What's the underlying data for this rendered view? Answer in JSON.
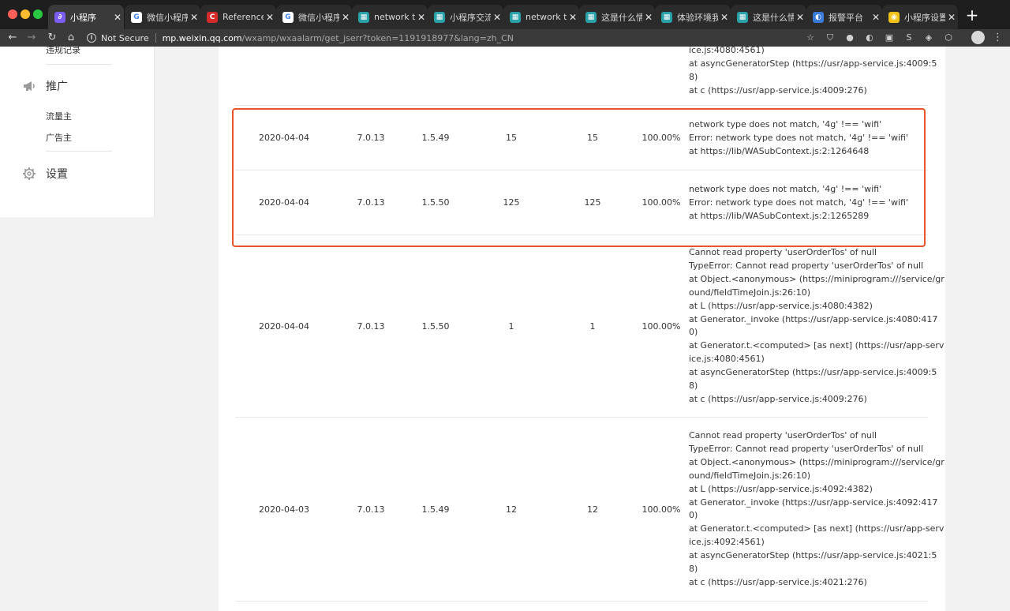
{
  "browser": {
    "tabs": [
      {
        "title": "小程序",
        "icon_color": "#7a5cf0",
        "icon_glyph": "∂",
        "active": true
      },
      {
        "title": "微信小程序",
        "icon_color": "#ffffff",
        "icon_glyph": "G",
        "active": false
      },
      {
        "title": "ReferenceE",
        "icon_color": "#d42a2a",
        "icon_glyph": "C",
        "active": false
      },
      {
        "title": "微信小程序",
        "icon_color": "#ffffff",
        "icon_glyph": "G",
        "active": false
      },
      {
        "title": "network typ",
        "icon_color": "#2aa1a8",
        "icon_glyph": "▦",
        "active": false
      },
      {
        "title": "小程序交流",
        "icon_color": "#2aa1a8",
        "icon_glyph": "▦",
        "active": false
      },
      {
        "title": "network typ",
        "icon_color": "#2aa1a8",
        "icon_glyph": "▦",
        "active": false
      },
      {
        "title": "这是什么情",
        "icon_color": "#2aa1a8",
        "icon_glyph": "▦",
        "active": false
      },
      {
        "title": "体验环境我",
        "icon_color": "#2aa1a8",
        "icon_glyph": "▦",
        "active": false
      },
      {
        "title": "这是什么情",
        "icon_color": "#2aa1a8",
        "icon_glyph": "▦",
        "active": false
      },
      {
        "title": "报警平台",
        "icon_color": "#3b7bd8",
        "icon_glyph": "◐",
        "active": false
      },
      {
        "title": "小程序设置",
        "icon_color": "#f2c21a",
        "icon_glyph": "◉",
        "active": false
      }
    ],
    "close_glyph": "✕",
    "new_tab_glyph": "+",
    "not_secure": "Not Secure",
    "url_host": "mp.weixin.qq.com",
    "url_path": "/wxamp/wxaalarm/get_jserr?token=1191918977&lang=zh_CN",
    "nav_icons": [
      "back-arrow-icon",
      "forward-arrow-icon",
      "reload-icon",
      "home-icon"
    ]
  },
  "sidebar": {
    "cut_item": "违规记录",
    "groups": [
      {
        "label": "推广",
        "icon": "megaphone-icon",
        "items": [
          "流量主",
          "广告主"
        ]
      },
      {
        "label": "设置",
        "icon": "gear-icon",
        "items": []
      }
    ]
  },
  "table": {
    "partial_top_lines": [
      "ice.js:4080:4561)",
      "at asyncGeneratorStep (https://usr/app-service.js:4009:5",
      "8)",
      "at c (https://usr/app-service.js:4009:276)"
    ],
    "rows": [
      {
        "date": "2020-04-04",
        "wechat_version": "7.0.13",
        "lib_version": "1.5.49",
        "count_a": "15",
        "count_b": "15",
        "ratio": "100.00%",
        "error_lines": [
          "network type does not match, '4g' !== 'wifi'",
          "Error: network type does not match, '4g' !== 'wifi'",
          "at https://lib/WASubContext.js:2:1264648"
        ]
      },
      {
        "date": "2020-04-04",
        "wechat_version": "7.0.13",
        "lib_version": "1.5.50",
        "count_a": "125",
        "count_b": "125",
        "ratio": "100.00%",
        "error_lines": [
          "network type does not match, '4g' !== 'wifi'",
          "Error: network type does not match, '4g' !== 'wifi'",
          "at https://lib/WASubContext.js:2:1265289"
        ]
      },
      {
        "date": "2020-04-04",
        "wechat_version": "7.0.13",
        "lib_version": "1.5.50",
        "count_a": "1",
        "count_b": "1",
        "ratio": "100.00%",
        "error_lines": [
          "Cannot read property 'userOrderTos' of null",
          "TypeError: Cannot read property 'userOrderTos' of null",
          "at Object.<anonymous> (https://miniprogram:///service/gr",
          "ound/fieldTimeJoin.js:26:10)",
          "at L (https://usr/app-service.js:4080:4382)",
          "at Generator._invoke (https://usr/app-service.js:4080:417",
          "0)",
          "at Generator.t.<computed> [as next] (https://usr/app-serv",
          "ice.js:4080:4561)",
          "at asyncGeneratorStep (https://usr/app-service.js:4009:5",
          "8)",
          "at c (https://usr/app-service.js:4009:276)"
        ]
      },
      {
        "date": "2020-04-03",
        "wechat_version": "7.0.13",
        "lib_version": "1.5.49",
        "count_a": "12",
        "count_b": "12",
        "ratio": "100.00%",
        "error_lines": [
          "Cannot read property 'userOrderTos' of null",
          "TypeError: Cannot read property 'userOrderTos' of null",
          "at Object.<anonymous> (https://miniprogram:///service/gr",
          "ound/fieldTimeJoin.js:26:10)",
          "at L (https://usr/app-service.js:4092:4382)",
          "at Generator._invoke (https://usr/app-service.js:4092:417",
          "0)",
          "at Generator.t.<computed> [as next] (https://usr/app-serv",
          "ice.js:4092:4561)",
          "at asyncGeneratorStep (https://usr/app-service.js:4021:5",
          "8)",
          "at c (https://usr/app-service.js:4021:276)"
        ]
      }
    ]
  },
  "colors": {
    "highlight_border": "#e8542c",
    "chrome_dark": "#1e1e1e",
    "page_bg": "#f2f2f2"
  }
}
